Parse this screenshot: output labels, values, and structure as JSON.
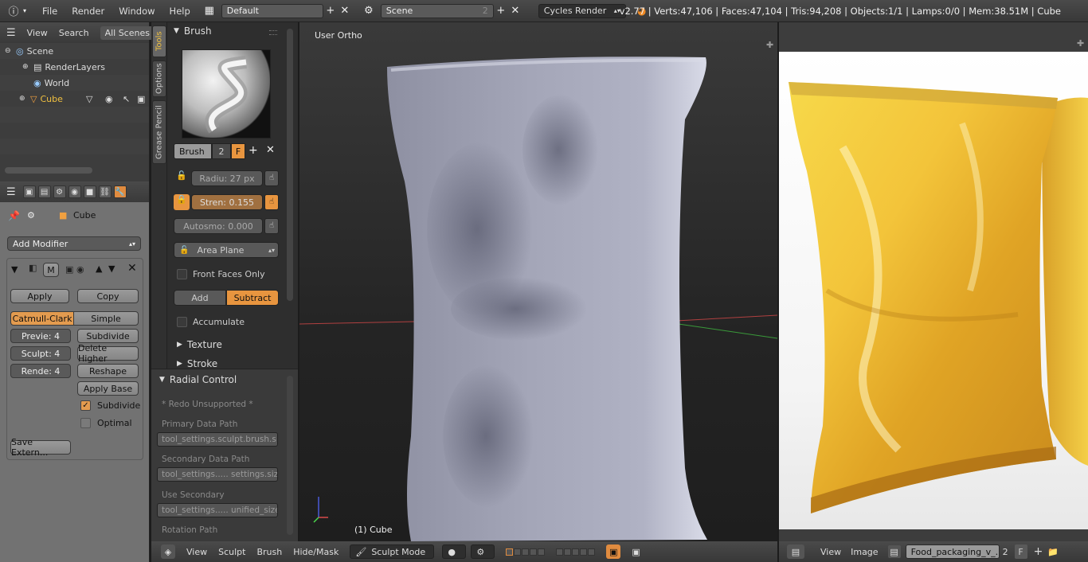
{
  "topbar": {
    "menus": [
      "File",
      "Render",
      "Window",
      "Help"
    ],
    "screen_layout": "Default",
    "scene": "Scene",
    "scene_users": "2",
    "render_engine": "Cycles Render",
    "stats": "v2.77 | Verts:47,106 | Faces:47,104 | Tris:94,208 | Objects:1/1 | Lamps:0/0 | Mem:38.51M | Cube"
  },
  "outliner": {
    "header": [
      "View",
      "Search",
      "All Scenes"
    ],
    "items": [
      {
        "label": "Scene"
      },
      {
        "label": "RenderLayers"
      },
      {
        "label": "World"
      },
      {
        "label": "Cube"
      }
    ]
  },
  "properties": {
    "object": "Cube",
    "add_modifier": "Add Modifier",
    "mod_m": "M",
    "apply": "Apply",
    "copy": "Copy",
    "catmull": "Catmull-Clark",
    "simple": "Simple",
    "preview": "Previe: 4",
    "subdivide": "Subdivide",
    "sculpt": "Sculpt: 4",
    "delete_higher": "Delete Higher",
    "render": "Rende: 4",
    "reshape": "Reshape",
    "apply_base": "Apply Base",
    "subdivide_uvs": "Subdivide",
    "optimal": "Optimal",
    "save_external": "Save Extern..."
  },
  "tabs": [
    "Tools",
    "Options",
    "Grease Pencil"
  ],
  "tool_shelf": {
    "brush_panel": "Brush",
    "brush_name": "Brush",
    "brush_users": "2",
    "fake": "F",
    "radius": "Radiu: 27 px",
    "strength": "Stren: 0.155",
    "autosmooth": "Autosmo: 0.000",
    "area_plane": "Area Plane",
    "front_faces": "Front Faces Only",
    "add": "Add",
    "subtract": "Subtract",
    "accumulate": "Accumulate",
    "texture": "Texture",
    "stroke": "Stroke"
  },
  "redo": {
    "title": "Radial Control",
    "note": "* Redo Unsupported *",
    "primary_label": "Primary Data Path",
    "primary_value": "tool_settings.sculpt.brush.s...",
    "secondary_label": "Secondary Data Path",
    "secondary_value": "tool_settings..... settings.size",
    "use_secondary_label": "Use Secondary",
    "use_secondary_value": "tool_settings..... unified_size",
    "rotation_label": "Rotation Path"
  },
  "viewport": {
    "view_name": "User Ortho",
    "object_label": "(1) Cube"
  },
  "viewport_bar": {
    "menus": [
      "View",
      "Sculpt",
      "Brush",
      "Hide/Mask"
    ],
    "mode": "Sculpt Mode"
  },
  "image_bar": {
    "menus": [
      "View",
      "Image"
    ],
    "image_name": "Food_packaging_v_...",
    "users": "2",
    "fake": "F"
  },
  "colors": {
    "accent": "#e8953f",
    "background": "#3d3d3d"
  }
}
